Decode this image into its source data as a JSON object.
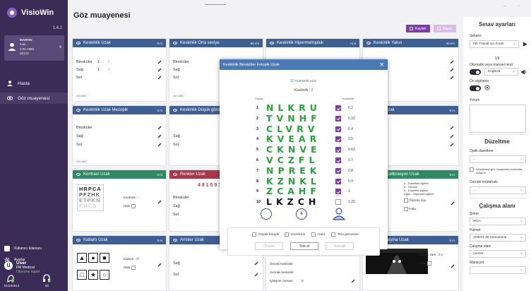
{
  "app": {
    "name": "VisioWin",
    "version": "1.4.2"
  },
  "patient": {
    "lines": [
      "MARTIN",
      "Ivan",
      "2.06.1980",
      "32123"
    ],
    "close": "x"
  },
  "nav": [
    {
      "label": "Hasta"
    },
    {
      "label": "Göz muayenesi"
    }
  ],
  "user": {
    "initial": "U",
    "name": "User",
    "org": "FM Medical",
    "status": "Oturumu kapat"
  },
  "links": {
    "guide": "Kullanıcı kılavuzu",
    "settings": "Ayarlar",
    "device_id": "EU240014",
    "battery": "50"
  },
  "page": {
    "title": "Göz muayenesi"
  },
  "toolbar": {
    "save": "Kaydet",
    "report": "Rapor"
  },
  "cards": {
    "c1": {
      "title": "Keskinlik Uzak",
      "tag": "5 m",
      "rows": [
        [
          "Binoküler",
          "1"
        ],
        [
          "Sağ",
          "1"
        ],
        [
          "Sol",
          ""
        ]
      ],
      "foot": "OO ABC"
    },
    "c2": {
      "title": "Keskinlik Orta seviye",
      "tag": "60 cm",
      "rows": [
        "Binoküler",
        "Sağ",
        "Sol"
      ],
      "foot": "OO ABC"
    },
    "c3": {
      "title": "Keskinlik Hipermetropluk",
      "tag": "+1.5",
      "foot": ""
    },
    "c4": {
      "title": "Keskinlik Yakın",
      "tag": "33 cm"
    },
    "c5": {
      "title": "Keskinlik Uzak Mezopik",
      "tag": "5 m",
      "rows": [
        "Binoküler",
        "Sağ",
        "Sol"
      ],
      "foot": "OO ABC"
    },
    "c6": {
      "title": "Keskinlik Düşük görüş",
      "tag": "5 m",
      "rows": [
        "Sağ",
        "Sol"
      ]
    },
    "c7": {
      "title": "Diğer Uzak",
      "tag": "5 m"
    },
    "c8": {
      "title": "Kontrast Uzak",
      "tag": "5 m",
      "chart": [
        "HRPCA",
        "PFZHK",
        "ETPKN",
        "KHCS"
      ],
      "label1": "Kontrast : -",
      "label2": "Hata"
    },
    "c9": {
      "title": "Renkler Uzak",
      "tag": "5 m",
      "digits": "4 8 1 5 9 7",
      "rows": [
        "Binoküler",
        "Sağ",
        "Sol"
      ]
    },
    "c10": {
      "title": "Kalibrasyon Uzak",
      "tag": "5 m",
      "items": [
        "4 - Düzeltimi eğilimi",
        "5 - Ortofori",
        "6 - Düzeltim eğilimi",
        "Diğer - Hipertrofi eğilimi"
      ],
      "extra1": "Ölçümü dışı",
      "extra2": "Hata"
    },
    "c11": {
      "title": "Kabartı Uzak",
      "tag": "5 m",
      "label": "Kabartı : 0°",
      "label2": "Hata"
    },
    "c12": {
      "title": "Amsler Uzak",
      "tag": "5 m",
      "rows": [
        "Sağ",
        "Sol"
      ]
    },
    "c13": {
      "title": "Renkli kamaşma Uzak",
      "tag": "5 m",
      "label": "Geçen süre : 0 s",
      "label2": "Hata"
    },
    "c14": {
      "rows": [
        "Önceki keskinlik:",
        "Sonraki keskinlik:",
        "İyileşme zamanı:"
      ],
      "val": "0"
    }
  },
  "modal": {
    "title": "Keskinlik Binoküler Fotopik Uzak",
    "line_info": "10 numaralı sıra:",
    "acuity": "Keskinlik : 1",
    "col_left": "Sıralar",
    "col_right": "Keskinlik",
    "rows": [
      {
        "n": "1",
        "letters": "NLKRU",
        "val": "0.2",
        "checked": true
      },
      {
        "n": "2",
        "letters": "TVNHF",
        "val": "0.32",
        "checked": true
      },
      {
        "n": "3",
        "letters": "CLVRV",
        "val": "0.4",
        "checked": true
      },
      {
        "n": "4",
        "letters": "KVEAR",
        "val": "0.5",
        "checked": true
      },
      {
        "n": "5",
        "letters": "CKNVE",
        "val": "0.63",
        "checked": true
      },
      {
        "n": "6",
        "letters": "VCZFL",
        "val": "0.7",
        "checked": true
      },
      {
        "n": "7",
        "letters": "NPREK",
        "val": "0.8",
        "checked": true
      },
      {
        "n": "8",
        "letters": "KZNKL",
        "val": "0.9",
        "checked": true
      },
      {
        "n": "9",
        "letters": "ZCAHF",
        "val": "1",
        "checked": true
      },
      {
        "n": "10",
        "letters": "LKZCH",
        "val": "1.25",
        "checked": false
      }
    ],
    "options": [
      "Düşük fotopik",
      "Düzeltme",
      "Hata",
      "Test görüntüle"
    ],
    "buttons": {
      "prev": "Önceki",
      "finish": "Terk et",
      "next": "Sonraki"
    }
  },
  "right": {
    "title": "Sınav ayarları",
    "screen_label": "Sekans",
    "screen_value": "FR-Travail sur écran",
    "counter": "1/9",
    "auto_label": "Otomatik veya manuel mod",
    "lang_value": "Engleză",
    "sound_label": "Ön algılama",
    "notes_label": "Yorum",
    "corr_title": "Düzeltme",
    "optic_label": "Optik düzeltme",
    "optic_value": "...",
    "check_label": "Düzeltmeyi göz muayenesi sırasında kullanın",
    "surg_label": "Cerrahi müdahale",
    "surg_value": "...",
    "work_title": "Çalışma alanı",
    "company_label": "Şirket",
    "company_value": "IKEA",
    "service_label": "Hizmet",
    "service_value": "Ateliers de menuiserie",
    "area_label": "Çalışma alanı",
    "area_value": "ouvrier",
    "post_label": "Mansıyet",
    "post_value": ""
  },
  "colors": {
    "accent": "#7e3aa6",
    "sidebar": "#3a2c57",
    "header_blue": "#3d5f93",
    "header_green": "#2f8a63",
    "header_red": "#a8374a",
    "letters": "#2aa13a"
  }
}
